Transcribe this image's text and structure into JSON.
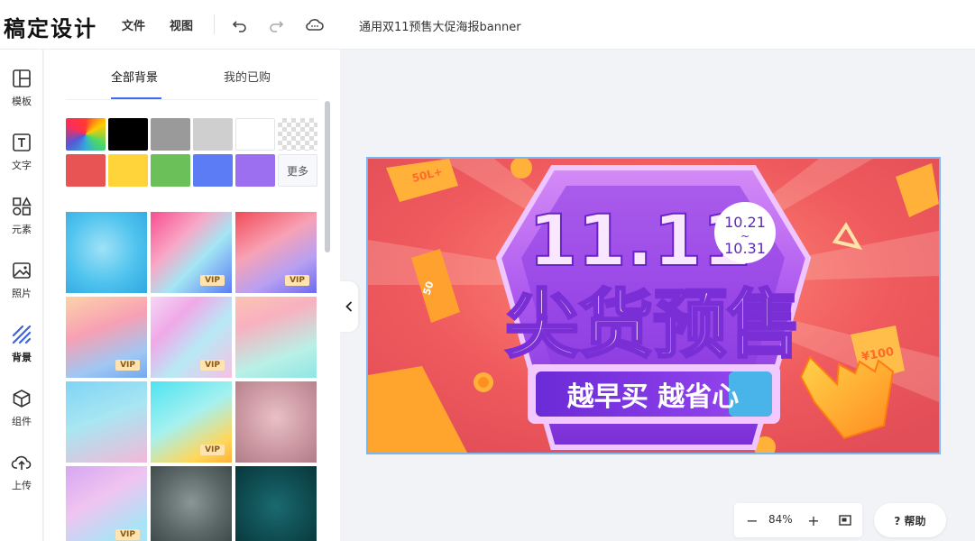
{
  "header": {
    "logo": "稿定设计",
    "menu": [
      {
        "label": "文件"
      },
      {
        "label": "视图"
      }
    ],
    "doc_title": "通用双11预售大促海报banner"
  },
  "sidebar": {
    "items": [
      {
        "label": "模板",
        "icon": "template-icon"
      },
      {
        "label": "文字",
        "icon": "text-icon"
      },
      {
        "label": "元素",
        "icon": "elements-icon"
      },
      {
        "label": "照片",
        "icon": "photo-icon"
      },
      {
        "label": "背景",
        "icon": "background-icon"
      },
      {
        "label": "组件",
        "icon": "component-icon"
      },
      {
        "label": "上传",
        "icon": "upload-icon"
      }
    ],
    "active": "背景"
  },
  "panel": {
    "tabs": [
      {
        "label": "全部背景"
      },
      {
        "label": "我的已购"
      }
    ],
    "colors": [
      "rainbow",
      "#000000",
      "#9a9a9a",
      "#cfcfcf",
      "#ffffff",
      "transparent",
      "#e85453",
      "#ffd43a",
      "#6cc05a",
      "#5b7cf5",
      "#9b6ff0"
    ],
    "more_label": "更多",
    "vip_label": "VIP"
  },
  "banner": {
    "date_label": "11.11",
    "date_range_start": "10.21",
    "date_range_sep": "~",
    "date_range_end": "10.31",
    "headline": "尖货预售",
    "slogan": "越早买 越省心",
    "ticket_1": "50",
    "ticket_2": "¥100"
  },
  "zoom": {
    "minus": "−",
    "value": "84%",
    "plus": "+"
  },
  "help_label": "? 帮助"
}
